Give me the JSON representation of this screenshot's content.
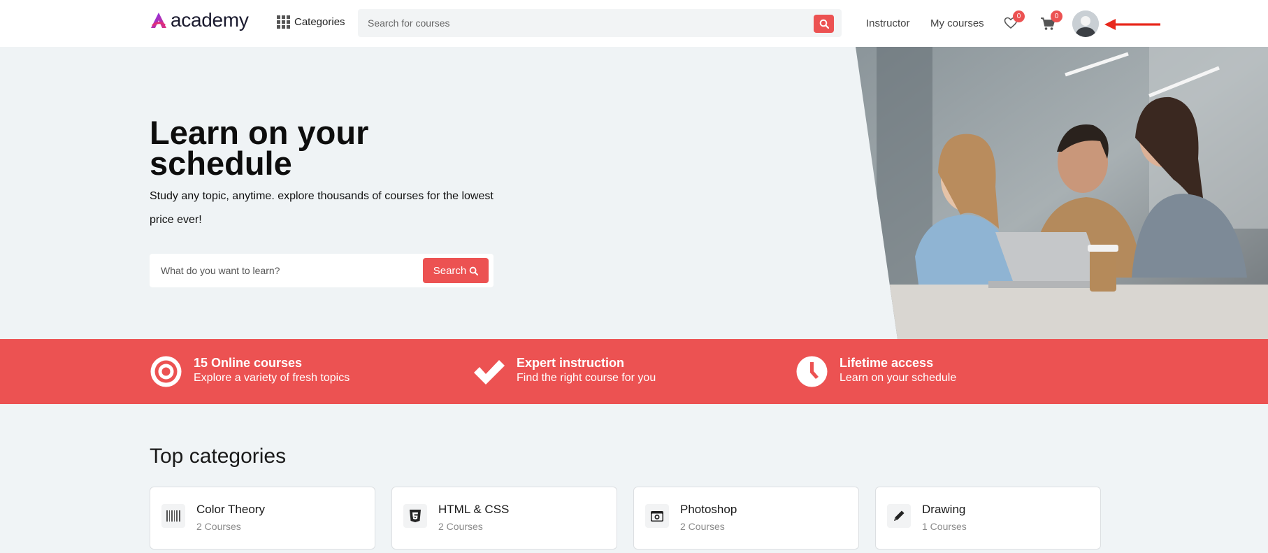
{
  "header": {
    "logo_text": "academy",
    "categories_label": "Categories",
    "search_placeholder": "Search for courses",
    "nav": {
      "instructor": "Instructor",
      "my_courses": "My courses"
    },
    "wishlist_count": "0",
    "cart_count": "0"
  },
  "hero": {
    "title": "Learn on your schedule",
    "subtitle": "Study any topic, anytime. explore thousands of courses for the lowest price ever!",
    "search_placeholder": "What do you want to learn?",
    "search_button": "Search"
  },
  "features": [
    {
      "title": "15 Online courses",
      "desc": "Explore a variety of fresh topics",
      "icon": "target-icon"
    },
    {
      "title": "Expert instruction",
      "desc": "Find the right course for you",
      "icon": "check-icon"
    },
    {
      "title": "Lifetime access",
      "desc": "Learn on your schedule",
      "icon": "clock-icon"
    }
  ],
  "categories_section": {
    "title": "Top categories",
    "items": [
      {
        "name": "Color Theory",
        "count": "2 Courses",
        "icon": "barcode-icon"
      },
      {
        "name": "HTML & CSS",
        "count": "2 Courses",
        "icon": "css3-icon"
      },
      {
        "name": "Photoshop",
        "count": "2 Courses",
        "icon": "camera-icon"
      },
      {
        "name": "Drawing",
        "count": "1 Courses",
        "icon": "pencil-icon"
      }
    ]
  },
  "colors": {
    "accent": "#ec5252",
    "hero_bg": "#eff3f5",
    "annotation_arrow": "#e8281c"
  }
}
